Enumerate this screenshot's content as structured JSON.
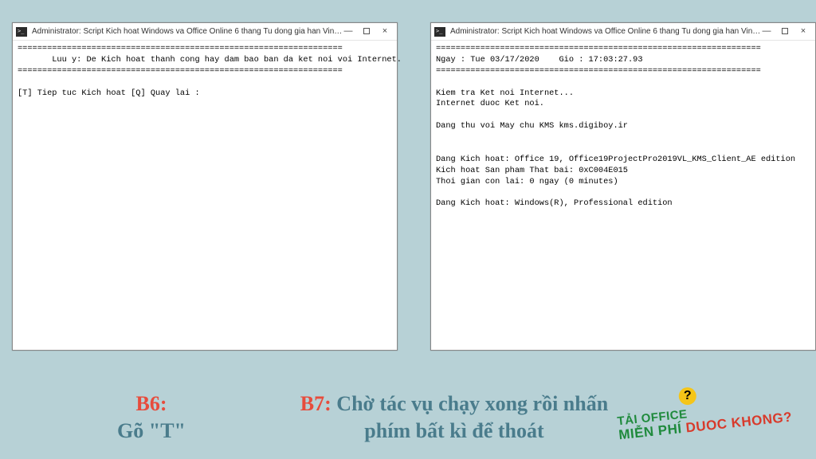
{
  "leftWindow": {
    "title": "Administrator:  Script Kich hoat Windows va Office Online 6 thang Tu dong gia han Vinh Vien - Copyrig...",
    "body": "==================================================================\n       Luu y: De Kich hoat thanh cong hay dam bao ban da ket noi voi Internet.\n==================================================================\n\n[T] Tiep tuc Kich hoat [Q] Quay lai :"
  },
  "rightWindow": {
    "title": "Administrator:  Script Kich hoat Windows va Office Online 6 thang Tu dong gia han Vinh Vien - Copyrig...",
    "body": "==================================================================\nNgay : Tue 03/17/2020    Gio : 17:03:27.93\n==================================================================\n\nKiem tra Ket noi Internet...\nInternet duoc Ket noi.\n\nDang thu voi May chu KMS kms.digiboy.ir\n\n\nDang Kich hoat: Office 19, Office19ProjectPro2019VL_KMS_Client_AE edition\nKich hoat San pham That bai: 0xC004E015\nThoi gian con lai: 0 ngay (0 minutes)\n\nDang Kich hoat: Windows(R), Professional edition"
  },
  "captions": {
    "b6_label": "B6:",
    "b6_text": "Gõ \"T\"",
    "b7_label": "B7: ",
    "b7_text": "Chờ tác vụ chạy xong rồi nhấn phím bất kì để thoát"
  },
  "logo": {
    "line1a": "TẢI OFFICE",
    "line1b": "",
    "line2a": "MIỄN PHÍ",
    "line2b": "DUOC KHONG?",
    "q": "?"
  },
  "controls": {
    "min": "—",
    "close": "×"
  }
}
